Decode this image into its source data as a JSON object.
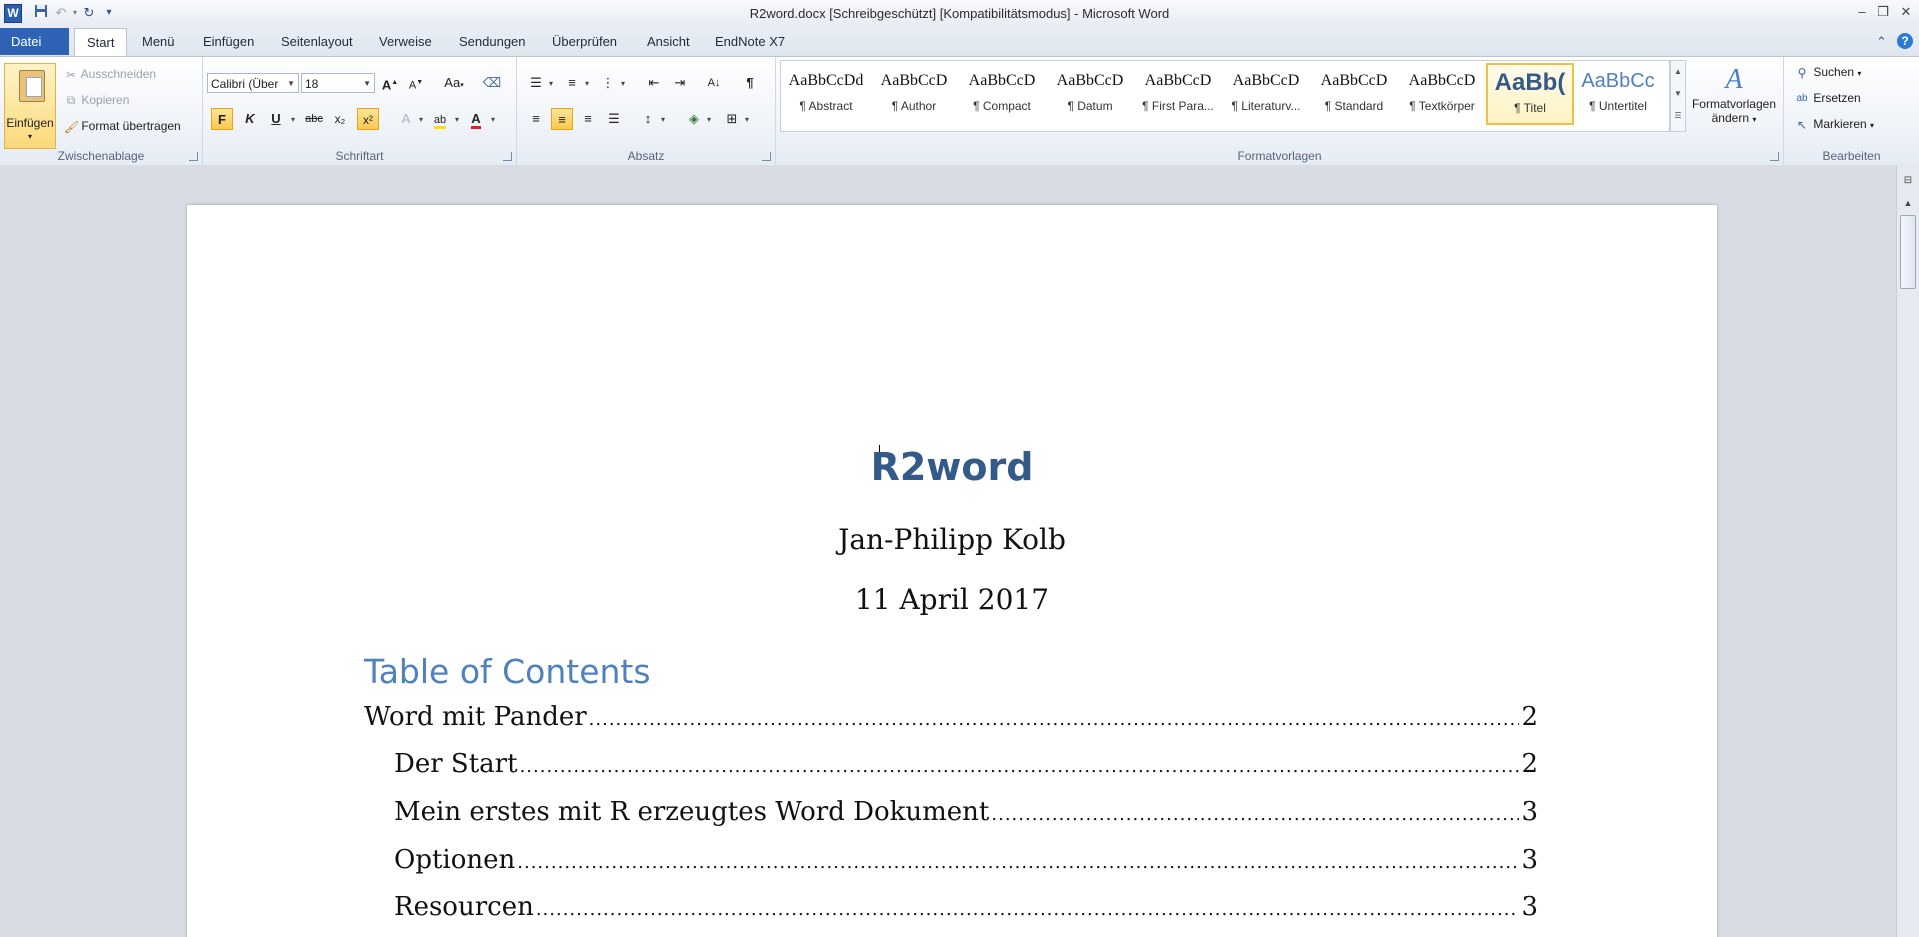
{
  "window": {
    "title": "R2word.docx [Schreibgeschützt] [Kompatibilitätsmodus]  -  Microsoft Word",
    "app_icon_letter": "W"
  },
  "quick_access": {
    "save_icon": "save-icon",
    "undo_icon": "undo-icon",
    "redo_icon": "redo-icon",
    "customize_icon": "customize-icon"
  },
  "tabs": [
    {
      "label": "Datei"
    },
    {
      "label": "Start"
    },
    {
      "label": "Menü"
    },
    {
      "label": "Einfügen"
    },
    {
      "label": "Seitenlayout"
    },
    {
      "label": "Verweise"
    },
    {
      "label": "Sendungen"
    },
    {
      "label": "Überprüfen"
    },
    {
      "label": "Ansicht"
    },
    {
      "label": "EndNote X7"
    }
  ],
  "ribbon": {
    "clipboard": {
      "label": "Zwischenablage",
      "paste": "Einfügen",
      "cut": "Ausschneiden",
      "copy": "Kopieren",
      "format_painter": "Format übertragen"
    },
    "font": {
      "label": "Schriftart",
      "font_name": "Calibri (Über",
      "font_size": "18",
      "bold": "F",
      "italic": "K",
      "underline": "U",
      "strike": "abc",
      "subscript": "x₂",
      "superscript": "x²",
      "grow": "A",
      "shrink": "A",
      "case": "Aa"
    },
    "paragraph": {
      "label": "Absatz"
    },
    "styles": {
      "label": "Formatvorlagen",
      "items": [
        {
          "sample": "AaBbCcDd",
          "name": "¶ Abstract"
        },
        {
          "sample": "AaBbCcD",
          "name": "¶ Author"
        },
        {
          "sample": "AaBbCcD",
          "name": "¶ Compact"
        },
        {
          "sample": "AaBbCcD",
          "name": "¶ Datum"
        },
        {
          "sample": "AaBbCcD",
          "name": "¶ First Para..."
        },
        {
          "sample": "AaBbCcD",
          "name": "¶ Literaturv..."
        },
        {
          "sample": "AaBbCcD",
          "name": "¶ Standard"
        },
        {
          "sample": "AaBbCcD",
          "name": "¶ Textkörper"
        },
        {
          "sample": "AaBb(",
          "name": "¶ Titel"
        },
        {
          "sample": "AaBbCc",
          "name": "¶ Untertitel"
        }
      ],
      "change_styles_line1": "Formatvorlagen",
      "change_styles_line2": "ändern"
    },
    "editing": {
      "label": "Bearbeiten",
      "find": "Suchen",
      "replace": "Ersetzen",
      "select": "Markieren"
    }
  },
  "document": {
    "title": "R2word",
    "author": "Jan-Philipp Kolb",
    "date": "11 April 2017",
    "toc_heading": "Table of Contents",
    "toc": [
      {
        "text": "Word mit Pander",
        "page": "2",
        "level": 1
      },
      {
        "text": "Der Start",
        "page": "2",
        "level": 2
      },
      {
        "text": "Mein erstes mit R erzeugtes Word Dokument",
        "page": "3",
        "level": 2
      },
      {
        "text": "Optionen",
        "page": "3",
        "level": 2
      },
      {
        "text": "Resourcen",
        "page": "3",
        "level": 2
      }
    ]
  },
  "colors": {
    "title_blue": "#345a8a",
    "heading_blue": "#4f81bd",
    "file_tab": "#2d62b4"
  }
}
